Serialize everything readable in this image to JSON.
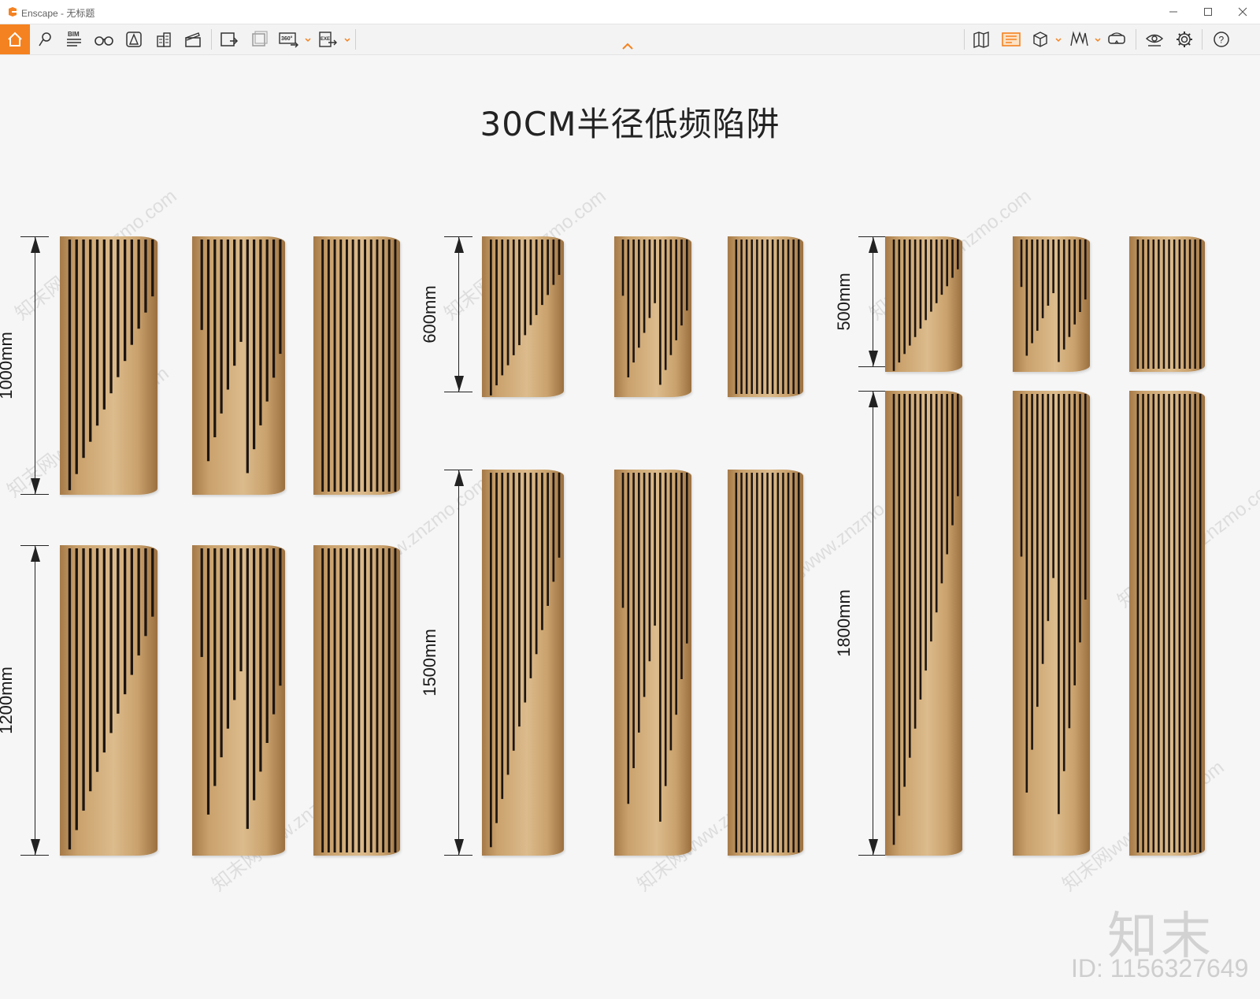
{
  "window": {
    "title": "Enscape - 无标题",
    "brand_color": "#f58220",
    "controls": [
      "minimize-icon",
      "maximize-icon",
      "close-icon"
    ]
  },
  "toolbar": {
    "left_buttons": [
      {
        "name": "home-button",
        "icon": "home-icon"
      },
      {
        "name": "location-button",
        "icon": "location-pin-icon"
      },
      {
        "name": "bim-button",
        "icon": "bim-icon",
        "label": "BIM"
      },
      {
        "name": "binoculars-button",
        "icon": "binoculars-icon"
      },
      {
        "name": "atmosphere-button",
        "icon": "atmosphere-icon"
      },
      {
        "name": "buildings-button",
        "icon": "buildings-icon"
      },
      {
        "name": "clapper-button",
        "icon": "clapper-icon"
      },
      {
        "name": "screenshot-button",
        "icon": "screenshot-icon"
      },
      {
        "name": "batch-render-button",
        "icon": "batch-render-icon"
      },
      {
        "name": "panorama-button",
        "icon": "panorama-icon",
        "label": "360°"
      },
      {
        "name": "export-exe-button",
        "icon": "export-exe-icon",
        "label": "EXE"
      }
    ],
    "right_buttons": [
      {
        "name": "map-button",
        "icon": "map-icon"
      },
      {
        "name": "asset-library-button",
        "icon": "asset-library-icon"
      },
      {
        "name": "cube-button",
        "icon": "cube-icon"
      },
      {
        "name": "material-button",
        "icon": "material-icon"
      },
      {
        "name": "vr-headset-button",
        "icon": "vr-headset-icon"
      },
      {
        "name": "visual-settings-button",
        "icon": "eye-icon"
      },
      {
        "name": "settings-button",
        "icon": "gear-icon"
      },
      {
        "name": "help-button",
        "icon": "help-icon"
      }
    ]
  },
  "viewport": {
    "title": "30CM半径低频陷阱",
    "dimensions": [
      "1000mm",
      "1200mm",
      "600mm",
      "1500mm",
      "500mm",
      "1800mm"
    ],
    "wood_color": "#c9a16c",
    "watermark_text": "知末网www.znzmo.com",
    "brand_mark": "知末",
    "image_id": "ID: 1156327649"
  }
}
